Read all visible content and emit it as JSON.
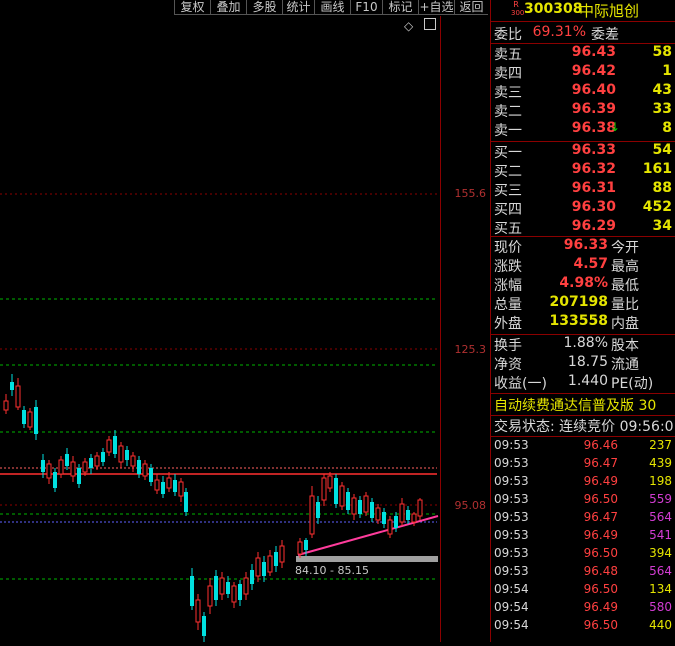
{
  "toolbar": {
    "buttons": [
      "复权",
      "叠加",
      "多股",
      "统计",
      "画线",
      "F10",
      "标记",
      "+自选",
      "返回"
    ]
  },
  "chart": {
    "price_axis_labels": [
      "155.6",
      "125.3",
      "95.08"
    ],
    "range_label": "84.10 - 85.15",
    "diamond_icon": "◇",
    "colors": {
      "up": "#ff3030",
      "down": "#00e0e0",
      "grid": "#8b0000",
      "support": "#00cc00",
      "trend": "#ff3c9c",
      "flag": "#ffe100"
    }
  },
  "stock": {
    "badge_top": "R",
    "badge_bottom": "300",
    "code": "300308",
    "name": "中际旭创"
  },
  "orderbook": {
    "ratio_label": "委比",
    "ratio_value": "69.31%",
    "diff_label": "委差",
    "asks": [
      {
        "label": "卖五",
        "price": "96.43",
        "vol": "58"
      },
      {
        "label": "卖四",
        "price": "96.42",
        "vol": "1"
      },
      {
        "label": "卖三",
        "price": "96.40",
        "vol": "43"
      },
      {
        "label": "卖二",
        "price": "96.39",
        "vol": "33"
      },
      {
        "label": "卖一",
        "price": "96.38",
        "vol": "8",
        "arrow": "↓"
      }
    ],
    "bids": [
      {
        "label": "买一",
        "price": "96.33",
        "vol": "54"
      },
      {
        "label": "买二",
        "price": "96.32",
        "vol": "161"
      },
      {
        "label": "买三",
        "price": "96.31",
        "vol": "88"
      },
      {
        "label": "买四",
        "price": "96.30",
        "vol": "452"
      },
      {
        "label": "买五",
        "price": "96.29",
        "vol": "34"
      }
    ]
  },
  "quote": [
    {
      "label": "现价",
      "value": "96.33",
      "label2": "今开"
    },
    {
      "label": "涨跌",
      "value": "4.57",
      "label2": "最高"
    },
    {
      "label": "涨幅",
      "value": "4.98%",
      "label2": "最低"
    },
    {
      "label": "总量",
      "value": "207198",
      "label2": "量比"
    },
    {
      "label": "外盘",
      "value": "133558",
      "label2": "内盘"
    }
  ],
  "fundamentals": [
    {
      "label": "换手",
      "value": "1.88%",
      "label2": "股本"
    },
    {
      "label": "净资",
      "value": "18.75",
      "label2": "流通"
    },
    {
      "label": "收益(一)",
      "value": "1.440",
      "label2": "PE(动)"
    }
  ],
  "promo": "自动续费通达信普及版 30",
  "status": "交易状态: 连续竞价 09:56:0",
  "ticks": [
    {
      "time": "09:53",
      "price": "96.46",
      "vol": "237",
      "c": "yel"
    },
    {
      "time": "09:53",
      "price": "96.47",
      "vol": "439",
      "c": "yel"
    },
    {
      "time": "09:53",
      "price": "96.49",
      "vol": "198",
      "c": "yel"
    },
    {
      "time": "09:53",
      "price": "96.50",
      "vol": "559",
      "c": "mag"
    },
    {
      "time": "09:53",
      "price": "96.47",
      "vol": "564",
      "c": "mag"
    },
    {
      "time": "09:53",
      "price": "96.49",
      "vol": "541",
      "c": "mag"
    },
    {
      "time": "09:53",
      "price": "96.50",
      "vol": "394",
      "c": "yel"
    },
    {
      "time": "09:53",
      "price": "96.48",
      "vol": "564",
      "c": "mag"
    },
    {
      "time": "09:54",
      "price": "96.50",
      "vol": "134",
      "c": "yel"
    },
    {
      "time": "09:54",
      "price": "96.49",
      "vol": "580",
      "c": "mag"
    },
    {
      "time": "09:54",
      "price": "96.50",
      "vol": "440",
      "c": "yel"
    }
  ]
}
